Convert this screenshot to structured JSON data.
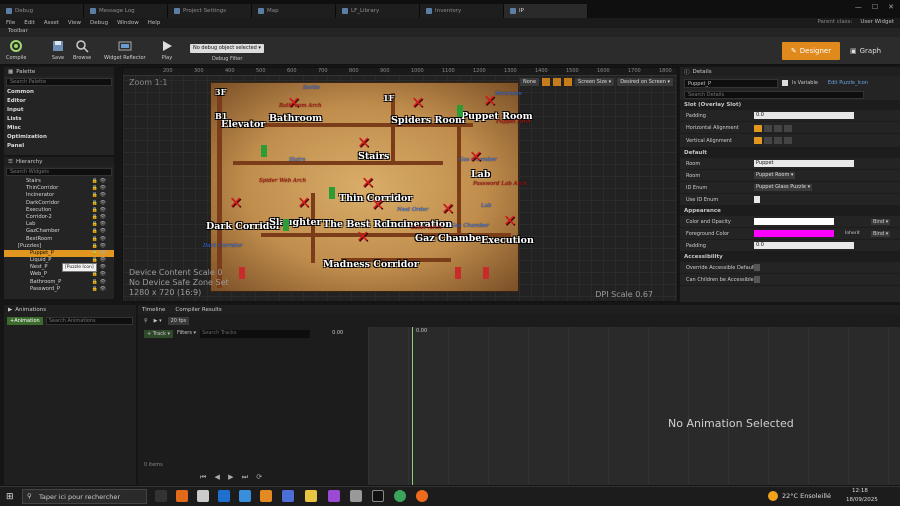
{
  "tabs": [
    "Debug",
    "Message Log",
    "Project Settings",
    "Map",
    "LF_Library",
    "Inventory",
    "IP"
  ],
  "menu": [
    "File",
    "Edit",
    "Asset",
    "View",
    "Debug",
    "Window",
    "Help"
  ],
  "menu_right": {
    "parent_label": "Parent class:",
    "parent_value": "User Widget"
  },
  "toolbar": {
    "title": "Toolbar",
    "compile": "Compile",
    "save": "Save",
    "browse": "Browse",
    "reflector": "Widget Reflector",
    "play": "Play",
    "debug_select": "No debug object selected ▾",
    "debug_filter": "Debug Filter",
    "designer": "Designer",
    "graph": "Graph"
  },
  "palette": {
    "title": "Palette",
    "search": "Search Palette",
    "categories": [
      "Common",
      "Editor",
      "Input",
      "Lists",
      "Misc",
      "Optimization",
      "Panel"
    ]
  },
  "hierarchy": {
    "title": "Hierarchy",
    "search": "Search Widgets",
    "items": [
      "Stairs",
      "ThinCorridor",
      "Incinerator",
      "DarkCorridor",
      "Execution",
      "Corridor-2",
      "Lab",
      "GazChamber",
      "BestRoom",
      "[Puzzles]",
      "Puppet_P",
      "Liquid_P",
      "Nest_P",
      "Web_P",
      "Bathroom_P",
      "Password_P"
    ],
    "selected": "Puppet_P",
    "tooltip": "[Puzzle Icon]"
  },
  "canvas": {
    "zoom": "Zoom 1:1",
    "buttons": [
      "None",
      "Screen Size ▾",
      "Desired on Screen ▾"
    ],
    "ruler_ticks": [
      "200",
      "300",
      "400",
      "500",
      "600",
      "700",
      "800",
      "900",
      "1000",
      "1100",
      "1200",
      "1300",
      "1400",
      "1500",
      "1600",
      "1700",
      "1800"
    ],
    "overlay": [
      "Device Content Scale 0",
      "No Device Safe Zone Set",
      "1280 x 720 (16:9)"
    ],
    "dpi": "DPI Scale 0.67"
  },
  "map": {
    "labels": [
      "3F",
      "B1",
      "Elevator",
      "Bathroom",
      "1F",
      "Spiders Room",
      "Puppet Room",
      "Stairs",
      "Lab",
      "Thin Corridor",
      "Dark Corridor",
      "Slaughter",
      "The Best Room",
      "Incineration",
      "Gaz Chamber",
      "Execution",
      "Madness Corridor"
    ],
    "hints_red": [
      "Bathroom Arch",
      "Spider Web Arch",
      "Password Lab Arch",
      "Laser Arch",
      "Puppet Arch"
    ],
    "hints_blue": [
      "Sortie",
      "Dark Corridor",
      "Stairs",
      "Nest Order",
      "Lab",
      "Gaz Chamber",
      "Restroom",
      "Gas Chamber"
    ]
  },
  "details": {
    "title": "Details",
    "name": "Puppet_P",
    "is_variable": "Is Variable",
    "edit": "Edit Puzzle_Icon",
    "search": "Search Details",
    "slot_section": "Slot (Overlay Slot)",
    "padding_label": "Padding",
    "padding_value": "0.0",
    "halign": "Horizontal Alignment",
    "valign": "Vertical Alignment",
    "default_section": "Default",
    "room_label": "Room",
    "room_value": "Puppet",
    "room2_label": "Room",
    "room2_value": "Puppet Room ▾",
    "enum_label": "ID Enum",
    "enum_value": "Puppet Glass Puzzle ▾",
    "use_enum": "Use ID Enum",
    "appearance_section": "Appearance",
    "color_opacity": "Color and Opacity",
    "fg_color": "Foreground Color",
    "inherit": "Inherit",
    "padding2": "Padding",
    "padding2_value": "0.0",
    "bind": "Bind ▾",
    "access_section": "Accessibility",
    "override": "Override Accessible Defaults",
    "children": "Can Children be Accessible",
    "accent": "#ff00ff"
  },
  "animations": {
    "tab": "Animations",
    "add": "+Animation",
    "search": "Search Animations"
  },
  "timeline": {
    "tabs": [
      "Timeline",
      "Compiler Results"
    ],
    "fps": "20 fps",
    "track": "+ Track ▾",
    "filters": "Filters ▾",
    "search": "Search Tracks",
    "time": "0.00",
    "no_anim": "No Animation Selected",
    "items": "0 items"
  },
  "taskbar": {
    "search": "Taper ici pour rechercher",
    "weather": "22°C Ensoleillé",
    "time": "12:18",
    "date": "18/09/2025"
  }
}
